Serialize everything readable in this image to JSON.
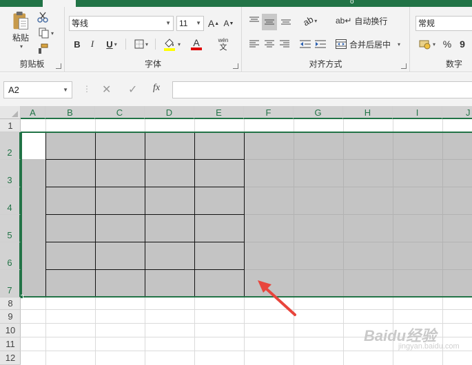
{
  "ribbon": {
    "clipboard": {
      "label": "剪贴板",
      "paste_label": "粘贴"
    },
    "font": {
      "label": "字体",
      "font_name": "等线",
      "font_size": "11",
      "bold": "B",
      "italic": "I",
      "underline": "U",
      "font_color_glyph": "A",
      "grow_glyph": "A",
      "shrink_glyph": "A",
      "fill_color": "#ffff00",
      "text_color": "#e00000",
      "phonetic_top": "wén",
      "phonetic_bottom": "文"
    },
    "alignment": {
      "label": "对齐方式",
      "wrap_text": "自动换行",
      "merge_center": "合并后居中"
    },
    "number": {
      "label": "数字",
      "format": "常规",
      "percent": "%",
      "comma": "9"
    }
  },
  "formula_bar": {
    "name_box": "A2",
    "fx": "fx",
    "formula_value": ""
  },
  "sheet": {
    "columns": [
      "A",
      "B",
      "C",
      "D",
      "E",
      "F",
      "G",
      "H",
      "I",
      "J"
    ],
    "rows": [
      "1",
      "2",
      "3",
      "4",
      "5",
      "6",
      "7",
      "8",
      "9",
      "10",
      "11",
      "12"
    ],
    "selection": "A2:J7",
    "accent_color": "#217346",
    "selection_fill": "#c4c4c4"
  },
  "watermark": {
    "text": "Baidu经验",
    "sub": "jingyan.baidu.com"
  },
  "annotation": {
    "arrow_color": "#e8453c"
  }
}
